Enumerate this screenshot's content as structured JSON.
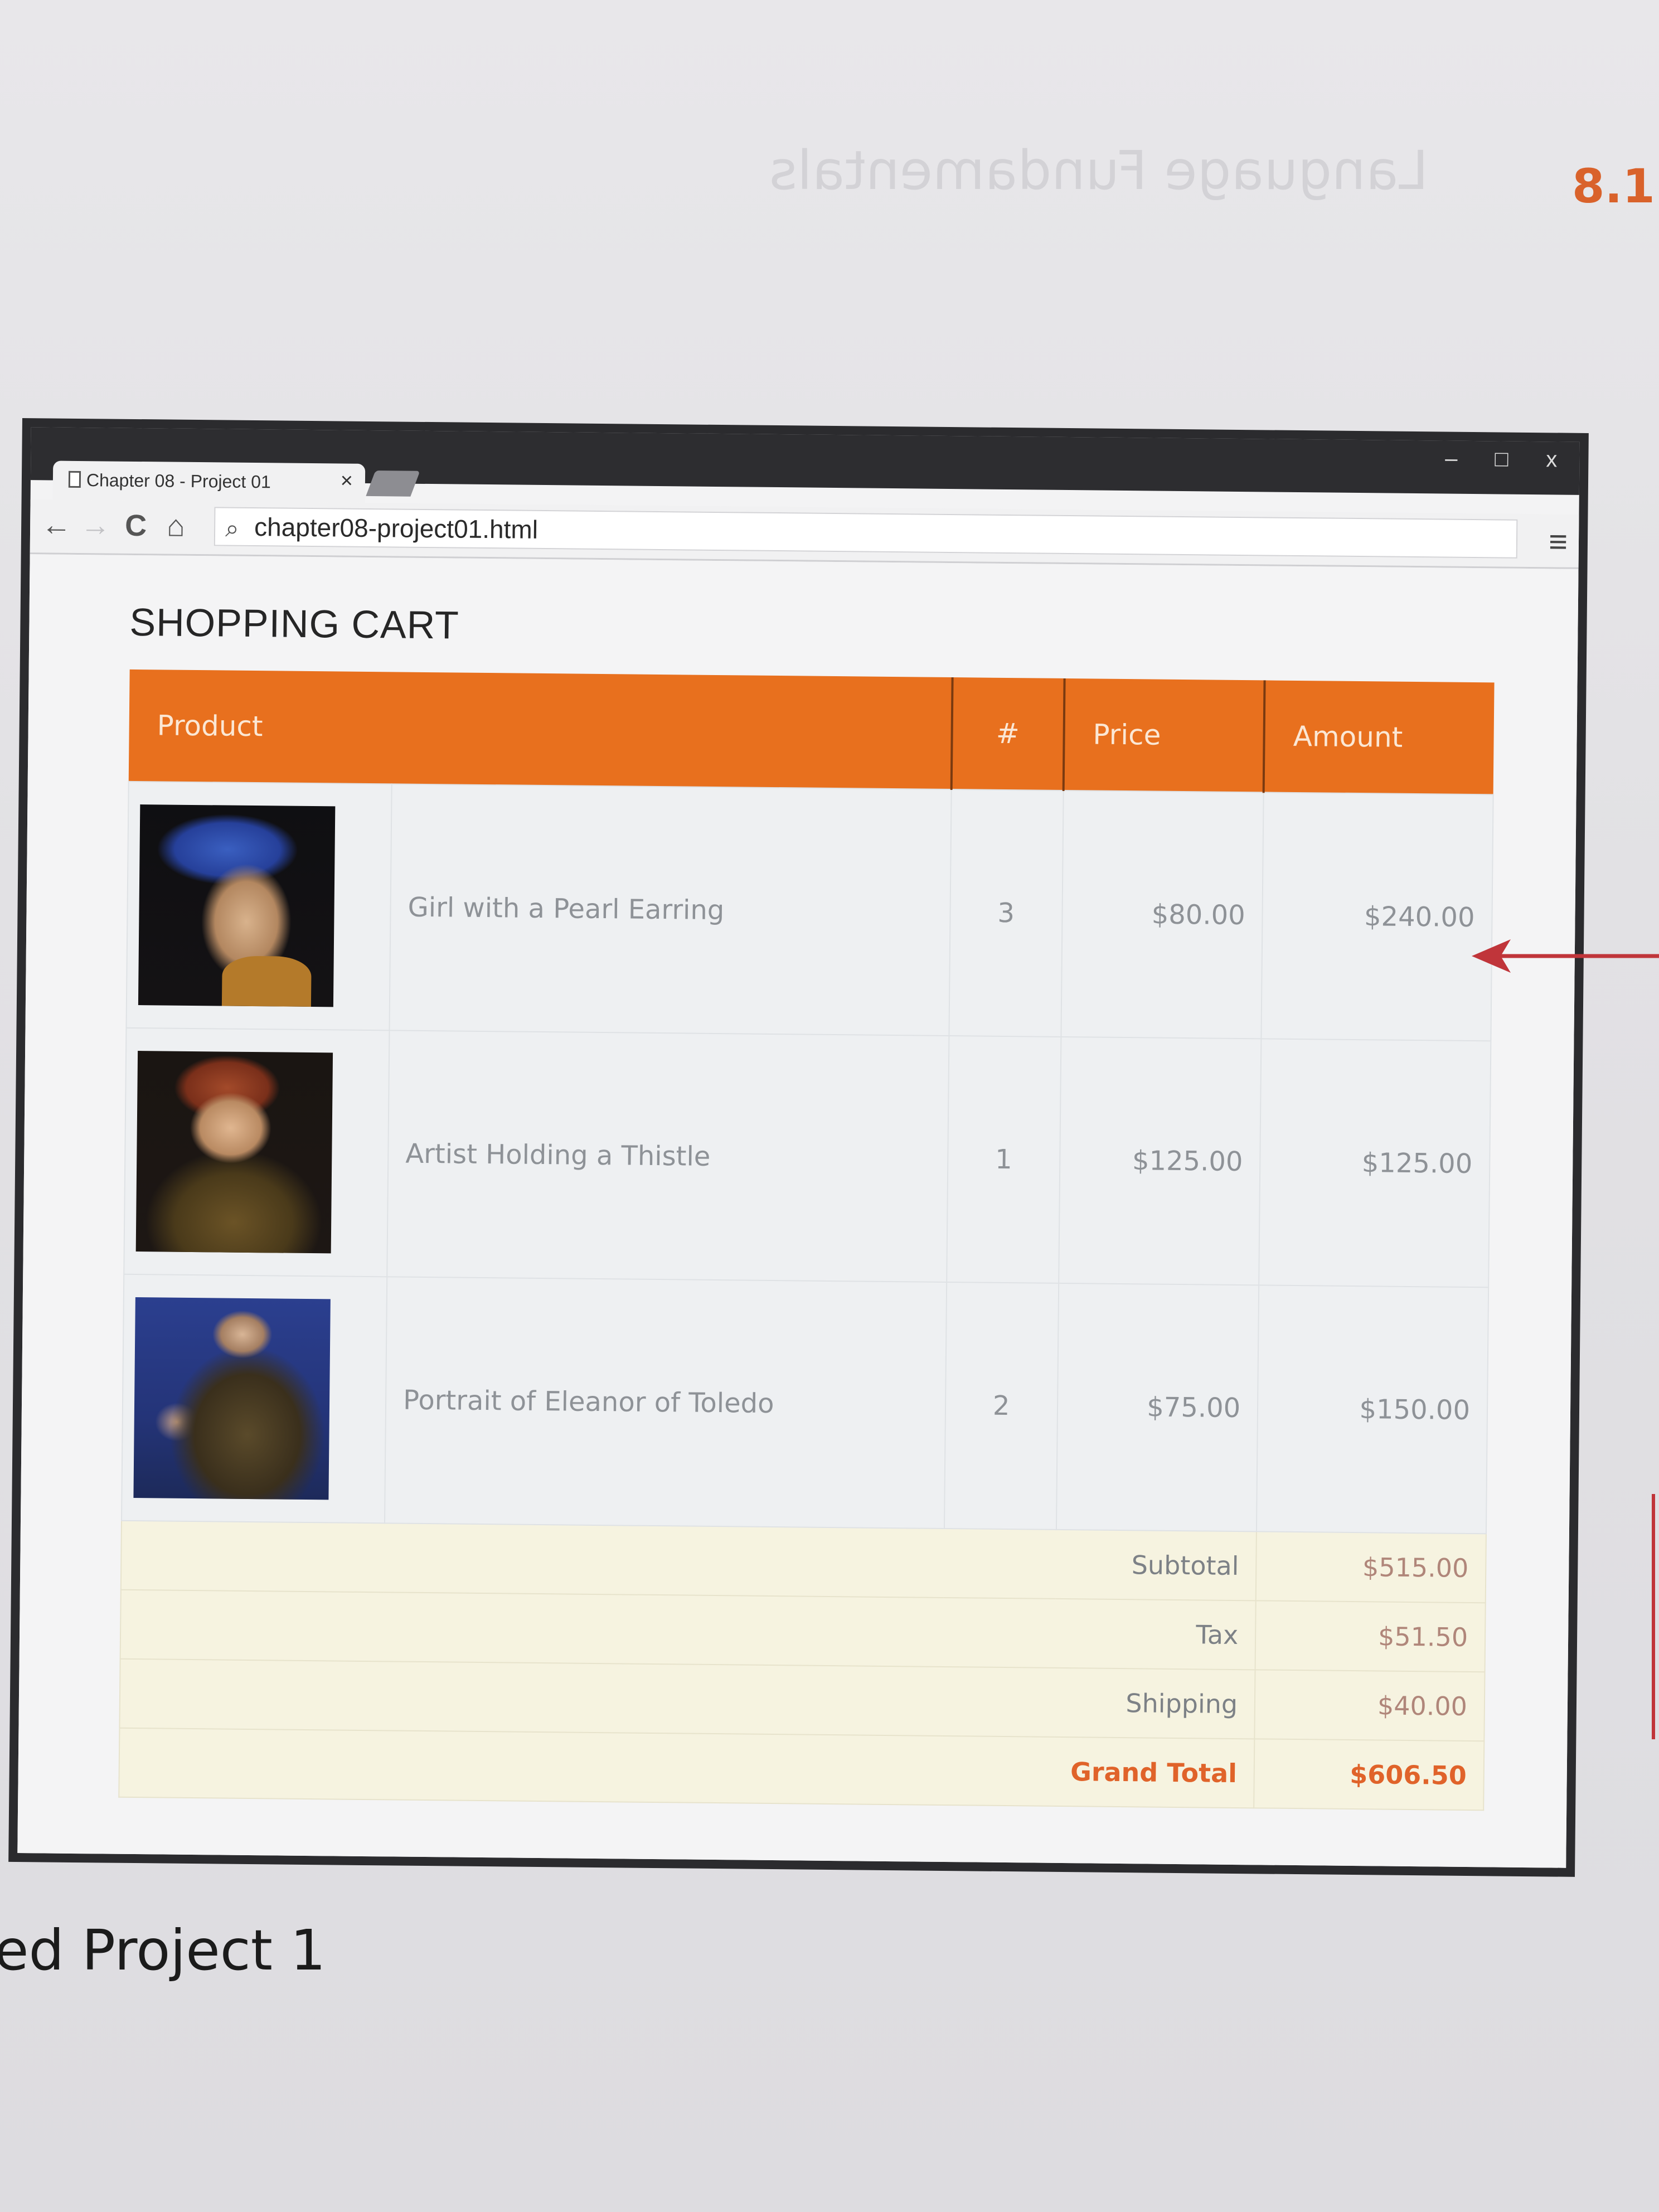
{
  "page": {
    "section_number": "8.1",
    "caption": "ed Project 1"
  },
  "browser": {
    "tab_title": "Chapter 08 - Project 01",
    "tab_close": "×",
    "url": "chapter08-project01.html",
    "window_controls": [
      "–",
      "□",
      "x"
    ]
  },
  "cart": {
    "title": "SHOPPING CART",
    "columns": [
      "Product",
      "#",
      "Price",
      "Amount"
    ],
    "items": [
      {
        "name": "Girl with a Pearl Earring",
        "qty": "3",
        "price": "$80.00",
        "amount": "$240.00",
        "image": "painting-thumbnail"
      },
      {
        "name": "Artist Holding a Thistle",
        "qty": "1",
        "price": "$125.00",
        "amount": "$125.00",
        "image": "painting-thumbnail"
      },
      {
        "name": "Portrait of Eleanor of Toledo",
        "qty": "2",
        "price": "$75.00",
        "amount": "$150.00",
        "image": "painting-thumbnail"
      }
    ],
    "totals": {
      "subtotal_label": "Subtotal",
      "subtotal": "$515.00",
      "tax_label": "Tax",
      "tax": "$51.50",
      "shipping_label": "Shipping",
      "shipping": "$40.00",
      "grand_label": "Grand Total",
      "grand": "$606.50"
    }
  },
  "colors": {
    "header_orange": "#e8701e",
    "grand_total": "#e0632a",
    "totals_background": "#f6f3e0"
  }
}
